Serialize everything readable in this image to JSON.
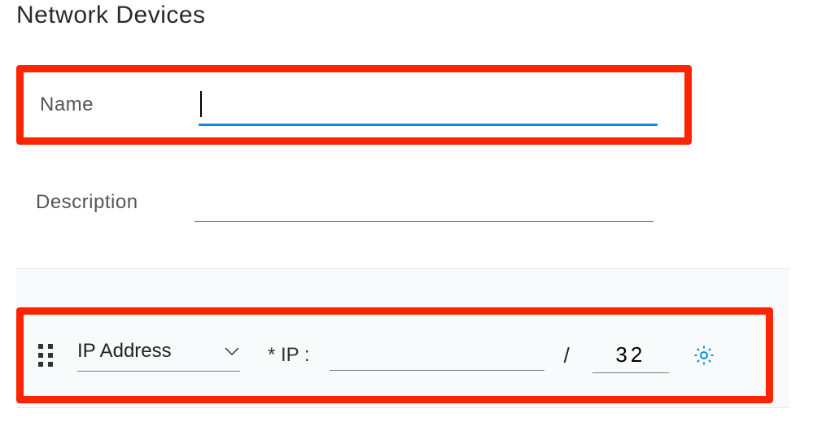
{
  "page": {
    "title": "Network Devices"
  },
  "fields": {
    "name_label": "Name",
    "name_value": "",
    "description_label": "Description",
    "description_value": ""
  },
  "ip_row": {
    "type_label": "IP Address",
    "ip_field_label": "* IP :",
    "ip_value": "",
    "separator": "/",
    "mask_value": "32"
  },
  "colors": {
    "accent": "#0f8ae0",
    "highlight": "#fe2400"
  }
}
